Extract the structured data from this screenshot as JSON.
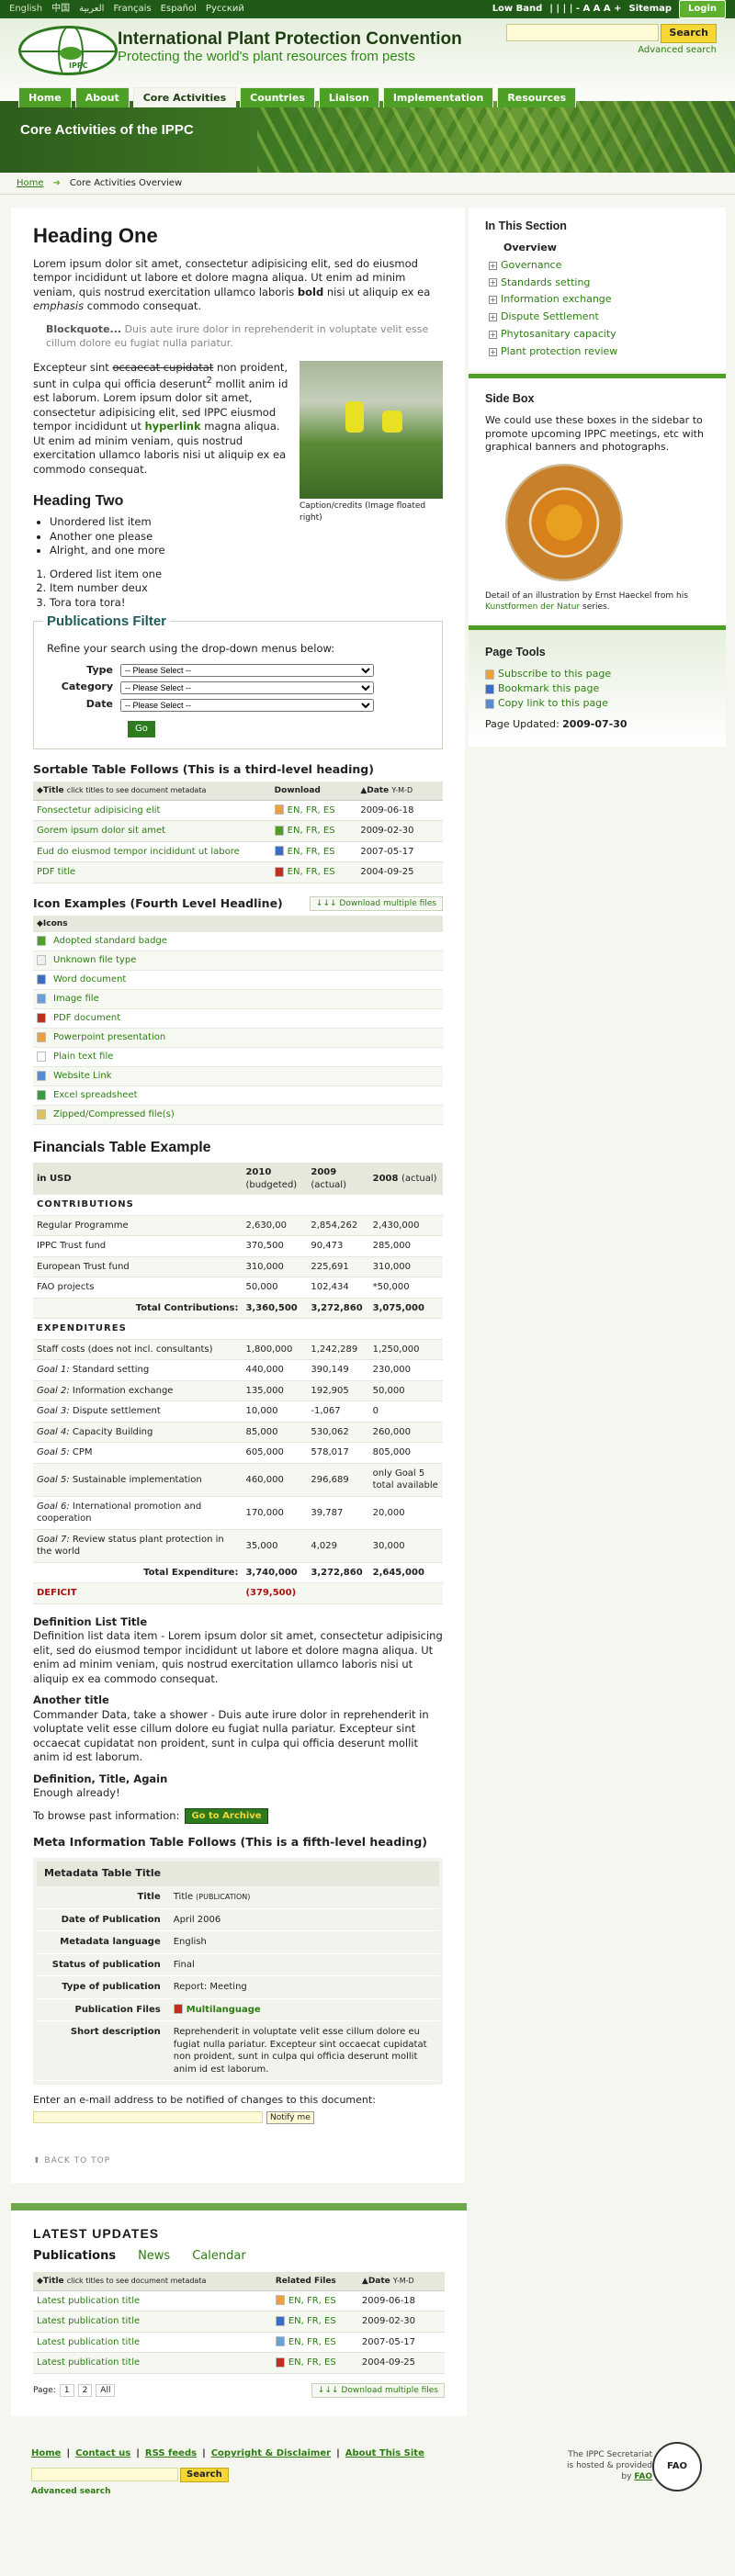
{
  "topbar": {
    "langs": [
      "English",
      "中国",
      "العربية",
      "Français",
      "Español",
      "Русский"
    ],
    "low_band": "Low Band",
    "a_sizes": "| | | | - A A A +",
    "sitemap": "Sitemap",
    "login": "Login"
  },
  "header": {
    "title": "International Plant Protection Convention",
    "subtitle": "Protecting the world's plant resources from pests",
    "logo_text": "IPPC",
    "search_button": "Search",
    "advanced": "Advanced search"
  },
  "nav": [
    "Home",
    "About",
    "Core Activities",
    "Countries",
    "Liaison",
    "Implementation",
    "Resources"
  ],
  "banner": {
    "title": "Core Activities of the IPPC"
  },
  "breadcrumb": {
    "home": "Home",
    "current": "Core Activities Overview"
  },
  "content": {
    "h1": "Heading One",
    "p1a": "Lorem ipsum dolor sit amet, consectetur adipisicing elit, sed do eiusmod tempor incididunt ut labore et dolore magna aliqua. Ut enim ad minim veniam, quis nostrud exercitation ullamco laboris ",
    "p1b": "bold",
    "p1c": " nisi ut aliquip ex ea ",
    "p1d": "emphasis",
    "p1e": " commodo consequat.",
    "bq_b": "Blockquote...",
    "bq": " Duis aute irure dolor in reprehenderit in voluptate velit esse cillum dolore eu fugiat nulla pariatur.",
    "p2a": "Excepteur sint ",
    "p2b": "occaecat cupidatat",
    "p2c": " non proident, sunt in culpa qui officia deserunt",
    "p2sup": "2",
    "p2d": " mollit anim id est laborum. Lorem ipsum dolor sit amet, consectetur adipisicing elit, sed IPPC eiusmod tempor incididunt ut ",
    "p2e": "hyperlink",
    "p2f": " magna aliqua. Ut enim ad minim veniam, quis nostrud exercitation ullamco laboris nisi ut aliquip ex ea commodo consequat.",
    "caption": "Caption/credits (Image floated right)",
    "h2": "Heading Two",
    "ul": [
      "Unordered list item",
      "Another one please",
      "Alright, and one more"
    ],
    "ol": [
      "Ordered list item one",
      "Item number deux",
      "Tora tora tora!"
    ]
  },
  "filter": {
    "title": "Publications Filter",
    "intro": "Refine your search using the drop-down menus below:",
    "fields": [
      "Type",
      "Category",
      "Date"
    ],
    "select": "-- Please Select --",
    "go": "Go"
  },
  "sortable": {
    "heading": "Sortable Table Follows (This is a third-level heading)",
    "cols": [
      "Title",
      "click titles to see document metadata",
      "Download",
      "Date",
      "Y-M-D"
    ],
    "rows": [
      {
        "title": "Fonsectetur adipisicing elit",
        "icon": "#e8a040",
        "date": "2009-06-18"
      },
      {
        "title": "Gorem ipsum dolor sit amet",
        "icon": "#4e9f26",
        "date": "2009-02-30"
      },
      {
        "title": "Eud do eiusmod tempor incididunt ut labore",
        "icon": "#3a6fc4",
        "date": "2007-05-17"
      },
      {
        "title": "PDF title",
        "icon": "#c03020",
        "date": "2004-09-25"
      }
    ],
    "langs": "EN, FR, ES"
  },
  "icons": {
    "heading": "Icon Examples (Fourth Level Headline)",
    "download": "↓↓↓ Download multiple files",
    "col": "Icons",
    "items": [
      {
        "label": "Adopted standard badge",
        "color": "#4e9f26",
        "name": "badge-icon"
      },
      {
        "label": "Unknown file type",
        "color": "#f0f0f0",
        "name": "unknown-file-icon"
      },
      {
        "label": "Word document",
        "color": "#3a6fc4",
        "name": "word-doc-icon"
      },
      {
        "label": "Image file",
        "color": "#6aa0d8",
        "name": "image-file-icon"
      },
      {
        "label": "PDF document",
        "color": "#c03020",
        "name": "pdf-icon"
      },
      {
        "label": "Powerpoint presentation",
        "color": "#e8a040",
        "name": "ppt-icon"
      },
      {
        "label": "Plain text file",
        "color": "#fafafa",
        "name": "text-file-icon"
      },
      {
        "label": "Website Link",
        "color": "#5a8ad0",
        "name": "link-icon"
      },
      {
        "label": "Excel spreadsheet",
        "color": "#3a9a40",
        "name": "excel-icon"
      },
      {
        "label": "Zipped/Compressed file(s)",
        "color": "#e0c060",
        "name": "zip-icon"
      }
    ]
  },
  "fin": {
    "heading": "Financials Table Example",
    "cols": [
      "in USD",
      "2010",
      "(budgeted)",
      "2009",
      "(actual)",
      "2008",
      "(actual)"
    ],
    "rows": [
      {
        "t": "sec",
        "c": [
          "CONTRIBUTIONS",
          "",
          "",
          ""
        ]
      },
      {
        "t": "r",
        "c": [
          "Regular Programme",
          "2,630,00",
          "2,854,262",
          "2,430,000"
        ]
      },
      {
        "t": "r",
        "c": [
          "IPPC Trust fund",
          "370,500",
          "90,473",
          "285,000"
        ]
      },
      {
        "t": "r",
        "c": [
          "European Trust fund",
          "310,000",
          "225,691",
          "310,000"
        ]
      },
      {
        "t": "r",
        "c": [
          "FAO projects",
          "50,000",
          "102,434",
          "*50,000"
        ]
      },
      {
        "t": "tot",
        "c": [
          "Total Contributions:",
          "3,360,500",
          "3,272,860",
          "3,075,000"
        ]
      },
      {
        "t": "sec",
        "c": [
          "EXPENDITURES",
          "",
          "",
          ""
        ]
      },
      {
        "t": "r",
        "c": [
          "Staff costs (does not incl. consultants)",
          "1,800,000",
          "1,242,289",
          "1,250,000"
        ]
      },
      {
        "t": "g",
        "g": "Goal 1:",
        "c": [
          " Standard setting",
          "440,000",
          "390,149",
          "230,000"
        ]
      },
      {
        "t": "g",
        "g": "Goal 2:",
        "c": [
          " Information exchange",
          "135,000",
          "192,905",
          "50,000"
        ]
      },
      {
        "t": "g",
        "g": "Goal 3:",
        "c": [
          " Dispute settlement",
          "10,000",
          "-1,067",
          "0"
        ]
      },
      {
        "t": "g",
        "g": "Goal 4:",
        "c": [
          " Capacity Building",
          "85,000",
          "530,062",
          "260,000"
        ]
      },
      {
        "t": "g",
        "g": "Goal 5:",
        "c": [
          " CPM",
          "605,000",
          "578,017",
          "805,000"
        ]
      },
      {
        "t": "g",
        "g": "Goal 5:",
        "c": [
          " Sustainable implementation",
          "460,000",
          "296,689",
          "only Goal 5 total available"
        ]
      },
      {
        "t": "g",
        "g": "Goal 6:",
        "c": [
          " International promotion and cooperation",
          "170,000",
          "39,787",
          "20,000"
        ]
      },
      {
        "t": "g",
        "g": "Goal 7:",
        "c": [
          " Review status plant protection in the world",
          "35,000",
          "4,029",
          "30,000"
        ]
      },
      {
        "t": "tot",
        "c": [
          "Total Expenditure:",
          "3,740,000",
          "3,272,860",
          "2,645,000"
        ]
      },
      {
        "t": "def",
        "c": [
          "DEFICIT",
          "(379,500)",
          "",
          ""
        ]
      }
    ]
  },
  "defs": {
    "t1": "Definition List Title",
    "d1": "Definition list data item - Lorem ipsum dolor sit amet, consectetur adipisicing elit, sed do eiusmod tempor incididunt ut labore et dolore magna aliqua. Ut enim ad minim veniam, quis nostrud exercitation ullamco laboris nisi ut aliquip ex ea commodo consequat.",
    "t2": "Another title",
    "d2": "Commander Data, take a shower - Duis aute irure dolor in reprehenderit in voluptate velit esse cillum dolore eu fugiat nulla pariatur. Excepteur sint occaecat cupidatat non proident, sunt in culpa qui officia deserunt mollit anim id est laborum.",
    "t3": "Definition, Title, Again",
    "d3": "Enough already!",
    "browse": "To browse past information:",
    "archive": "Go to Archive"
  },
  "meta": {
    "heading": "Meta Information Table Follows (This is a fifth-level heading)",
    "box_title": "Metadata Table Title",
    "rows": [
      {
        "k": "Title",
        "v": "Title",
        "s": "(PUBLICATION)"
      },
      {
        "k": "Date of Publication",
        "v": "April 2006"
      },
      {
        "k": "Metadata language",
        "v": "English"
      },
      {
        "k": "Status of publication",
        "v": "Final"
      },
      {
        "k": "Type of publication",
        "v": "Report: Meeting"
      },
      {
        "k": "Publication Files",
        "v": "Multilanguage"
      },
      {
        "k": "Short description",
        "v": "Reprehenderit in voluptate velit esse cillum dolore eu fugiat nulla pariatur. Excepteur sint occaecat cupidatat non proident, sunt in culpa qui officia deserunt mollit anim id est laborum."
      }
    ],
    "notify": "Enter an e-mail address to be notified of changes to this document:",
    "notify_btn": "Notify me",
    "back": "BACK TO TOP"
  },
  "side": {
    "section_title": "In This Section",
    "overview": "Overview",
    "links": [
      "Governance",
      "Standards setting",
      "Information exchange",
      "Dispute Settlement",
      "Phytosanitary capacity",
      "Plant protection review"
    ],
    "box_title": "Side Box",
    "box_text": "We could use these boxes in the sidebar to promote upcoming IPPC meetings, etc with graphical banners and photographs.",
    "box_cap1": "Detail of an illustration by Ernst Haeckel from his ",
    "box_cap2": "Kunstformen der Natur",
    "box_cap3": " series.",
    "tools_title": "Page Tools",
    "tools": [
      "Subscribe to this page",
      "Bookmark this page",
      "Copy link to this page"
    ],
    "updated_label": "Page Updated:",
    "updated": "2009-07-30"
  },
  "latest": {
    "title": "LATEST UPDATES",
    "tabs": [
      "Publications",
      "News",
      "Calendar"
    ],
    "cols": [
      "Title",
      "click titles to see document metadata",
      "Related Files",
      "Date",
      "Y-M-D"
    ],
    "rows": [
      {
        "title": "Latest publication title",
        "icon": "#e8a040",
        "date": "2009-06-18"
      },
      {
        "title": "Latest publication title",
        "icon": "#3a6fc4",
        "date": "2009-02-30"
      },
      {
        "title": "Latest publication title",
        "icon": "#6aa0d8",
        "date": "2007-05-17"
      },
      {
        "title": "Latest publication title",
        "icon": "#c03020",
        "date": "2004-09-25"
      }
    ],
    "langs": "EN, FR, ES",
    "page": "Page:",
    "pages": [
      "1",
      "2",
      "All"
    ],
    "download": "↓↓↓ Download multiple files"
  },
  "footer": {
    "links": [
      "Home",
      "Contact us",
      "RSS feeds",
      "Copyright & Disclaimer",
      "About This Site"
    ],
    "search": "Search",
    "advanced": "Advanced search",
    "hosted1": "The IPPC Secretariat",
    "hosted2": "is hosted & provided",
    "hosted3": "by ",
    "fao": "FAO",
    "fao_logo": "FAO"
  }
}
